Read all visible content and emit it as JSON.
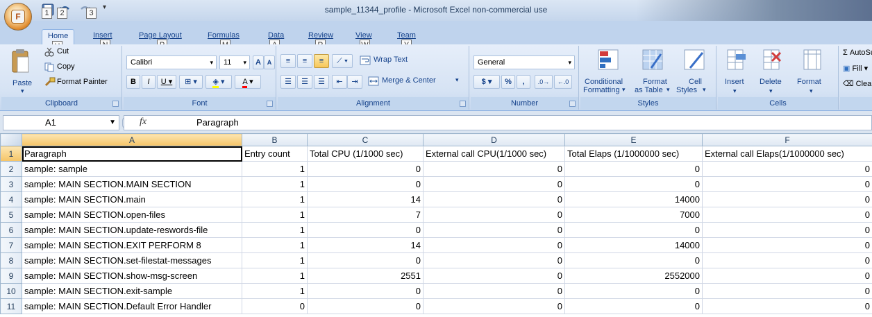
{
  "window": {
    "title": "sample_11344_profile - Microsoft Excel non-commercial use"
  },
  "quick_access": {
    "office_key": "F",
    "keytips": [
      "1",
      "2",
      "3"
    ]
  },
  "tabs": [
    {
      "label": "Home",
      "key": "H"
    },
    {
      "label": "Insert",
      "key": "N"
    },
    {
      "label": "Page Layout",
      "key": "P"
    },
    {
      "label": "Formulas",
      "key": "M"
    },
    {
      "label": "Data",
      "key": "A"
    },
    {
      "label": "Review",
      "key": "R"
    },
    {
      "label": "View",
      "key": "W"
    },
    {
      "label": "Team",
      "key": "Y"
    }
  ],
  "ribbon": {
    "clipboard": {
      "label": "Clipboard",
      "paste": "Paste",
      "cut": "Cut",
      "copy": "Copy",
      "format_painter": "Format Painter"
    },
    "font": {
      "label": "Font",
      "name": "Calibri",
      "size": "11"
    },
    "alignment": {
      "label": "Alignment",
      "wrap_text": "Wrap Text",
      "merge_center": "Merge & Center"
    },
    "number": {
      "label": "Number",
      "format": "General"
    },
    "styles": {
      "label": "Styles",
      "conditional": "Conditional",
      "conditional2": "Formatting",
      "format_as": "Format",
      "format_as2": "as Table",
      "cell_styles": "Cell",
      "cell_styles2": "Styles"
    },
    "cells": {
      "label": "Cells",
      "insert": "Insert",
      "delete": "Delete",
      "format": "Format"
    },
    "editing": {
      "autosum": "AutoSur",
      "fill": "Fill",
      "clear": "Clear"
    }
  },
  "formula_bar": {
    "name_box": "A1",
    "fx": "fx",
    "value": "Paragraph"
  },
  "sheet": {
    "columns": [
      "A",
      "B",
      "C",
      "D",
      "E",
      "F"
    ],
    "rows": [
      {
        "n": "1",
        "cells": [
          "Paragraph",
          "Entry count",
          "Total CPU (1/1000 sec)",
          "External call CPU(1/1000 sec)",
          "Total Elaps (1/1000000 sec)",
          "External call Elaps(1/1000000 sec)"
        ]
      },
      {
        "n": "2",
        "cells": [
          "sample: sample",
          "1",
          "0",
          "0",
          "0",
          "0"
        ]
      },
      {
        "n": "3",
        "cells": [
          "sample: MAIN SECTION.MAIN SECTION",
          "1",
          "0",
          "0",
          "0",
          "0"
        ]
      },
      {
        "n": "4",
        "cells": [
          "sample: MAIN SECTION.main",
          "1",
          "14",
          "0",
          "14000",
          "0"
        ]
      },
      {
        "n": "5",
        "cells": [
          "sample: MAIN SECTION.open-files",
          "1",
          "7",
          "0",
          "7000",
          "0"
        ]
      },
      {
        "n": "6",
        "cells": [
          "sample: MAIN SECTION.update-reswords-file",
          "1",
          "0",
          "0",
          "0",
          "0"
        ]
      },
      {
        "n": "7",
        "cells": [
          "sample: MAIN SECTION.EXIT PERFORM 8",
          "1",
          "14",
          "0",
          "14000",
          "0"
        ]
      },
      {
        "n": "8",
        "cells": [
          "sample: MAIN SECTION.set-filestat-messages",
          "1",
          "0",
          "0",
          "0",
          "0"
        ]
      },
      {
        "n": "9",
        "cells": [
          "sample: MAIN SECTION.show-msg-screen",
          "1",
          "2551",
          "0",
          "2552000",
          "0"
        ]
      },
      {
        "n": "10",
        "cells": [
          "sample: MAIN SECTION.exit-sample",
          "1",
          "0",
          "0",
          "0",
          "0"
        ]
      },
      {
        "n": "11",
        "cells": [
          "sample: MAIN SECTION.Default Error Handler",
          "0",
          "0",
          "0",
          "0",
          "0"
        ]
      }
    ]
  }
}
